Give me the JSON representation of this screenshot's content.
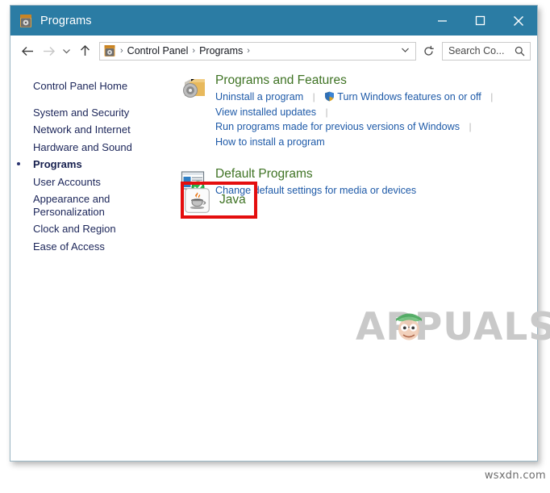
{
  "window": {
    "title": "Programs",
    "icon": "control-panel-icon",
    "controls": {
      "minimize": "–",
      "maximize": "□",
      "close": "✕"
    },
    "titlebar_color": "#2b7ca4"
  },
  "addressbar": {
    "back": "back-arrow",
    "forward": "forward-arrow",
    "recent": "chevron-down",
    "up": "up-arrow",
    "crumb_icon": "control-panel-icon",
    "breadcrumbs": [
      "Control Panel",
      "Programs"
    ],
    "separator": "›",
    "dropdown": "⌄",
    "refresh": "↻"
  },
  "search": {
    "value": "Search Co...",
    "placeholder": "Search Control Panel",
    "icon": "search-icon"
  },
  "sidebar": {
    "items": [
      {
        "label": "Control Panel Home",
        "current": false,
        "gap": false
      },
      {
        "label": "System and Security",
        "current": false,
        "gap": true
      },
      {
        "label": "Network and Internet",
        "current": false,
        "gap": false
      },
      {
        "label": "Hardware and Sound",
        "current": false,
        "gap": false
      },
      {
        "label": "Programs",
        "current": true,
        "gap": false
      },
      {
        "label": "User Accounts",
        "current": false,
        "gap": false
      },
      {
        "label": "Appearance and Personalization",
        "current": false,
        "gap": false
      },
      {
        "label": "Clock and Region",
        "current": false,
        "gap": false
      },
      {
        "label": "Ease of Access",
        "current": false,
        "gap": false
      }
    ]
  },
  "main": {
    "categories": [
      {
        "id": "programs-and-features",
        "title": "Programs and Features",
        "icon": "programs-features-icon",
        "links": [
          {
            "label": "Uninstall a program",
            "shield": false,
            "trailing_divider": true
          },
          {
            "label": "Turn Windows features on or off",
            "shield": true,
            "trailing_divider": true
          },
          {
            "label": "View installed updates",
            "shield": false,
            "trailing_divider": true
          },
          {
            "label": "Run programs made for previous versions of Windows",
            "shield": false,
            "trailing_divider": true
          },
          {
            "label": "How to install a program",
            "shield": false,
            "trailing_divider": false
          }
        ]
      },
      {
        "id": "default-programs",
        "title": "Default Programs",
        "icon": "default-programs-icon",
        "links": [
          {
            "label": "Change default settings for media or devices",
            "shield": false,
            "trailing_divider": false
          }
        ]
      }
    ],
    "java_item": {
      "label": "Java",
      "icon": "java-icon",
      "highlight_color": "#e40e0e"
    }
  },
  "watermarks": {
    "appuals": "APPUALS",
    "bottom_right": "wsxdn.com"
  },
  "colors": {
    "heading_green": "#3f7324",
    "link_blue": "#1e5aa8",
    "sidebar_navy": "#1b2559",
    "highlight_red": "#e40e0e",
    "titlebar": "#2b7ca4"
  }
}
